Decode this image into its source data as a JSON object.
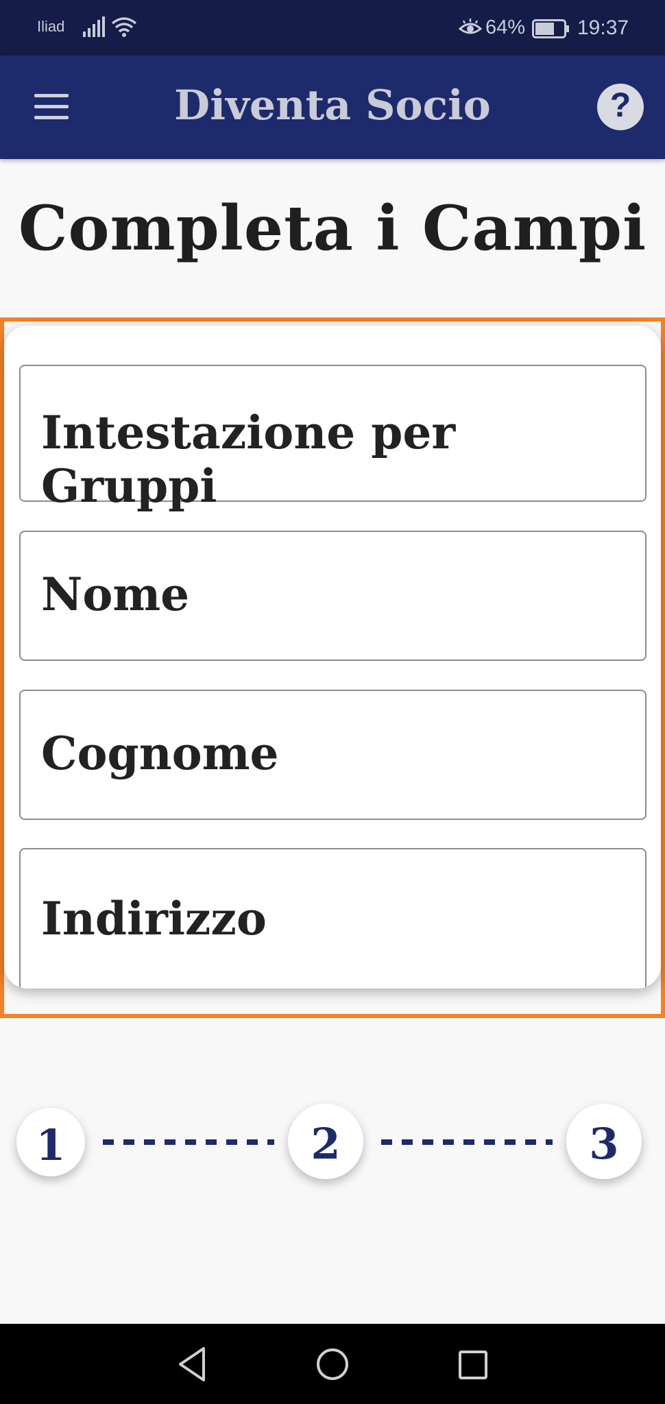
{
  "status_bar": {
    "carrier": "Iliad",
    "battery_percent": "64%",
    "time": "19:37",
    "icons": [
      "signal-icon",
      "wifi-icon",
      "eye-comfort-icon",
      "battery-icon"
    ]
  },
  "app_bar": {
    "title": "Diventa Socio",
    "menu_icon": "hamburger-menu-icon",
    "help_label": "?"
  },
  "page": {
    "title": "Completa i Campi"
  },
  "form": {
    "fields": [
      {
        "label": "Intestazione per Gruppi"
      },
      {
        "label": "Nome"
      },
      {
        "label": "Cognome"
      },
      {
        "label": "Indirizzo"
      }
    ]
  },
  "stepper": {
    "steps": [
      {
        "label": "1"
      },
      {
        "label": "2"
      },
      {
        "label": "3"
      }
    ]
  },
  "nav_bar": {
    "icons": [
      "back-icon",
      "home-icon",
      "recent-apps-icon"
    ]
  },
  "colors": {
    "status_bar_bg": "#141c47",
    "app_bar_bg": "#1d2a6b",
    "highlight_border": "#f58025",
    "accent": "#1d2a6b"
  }
}
